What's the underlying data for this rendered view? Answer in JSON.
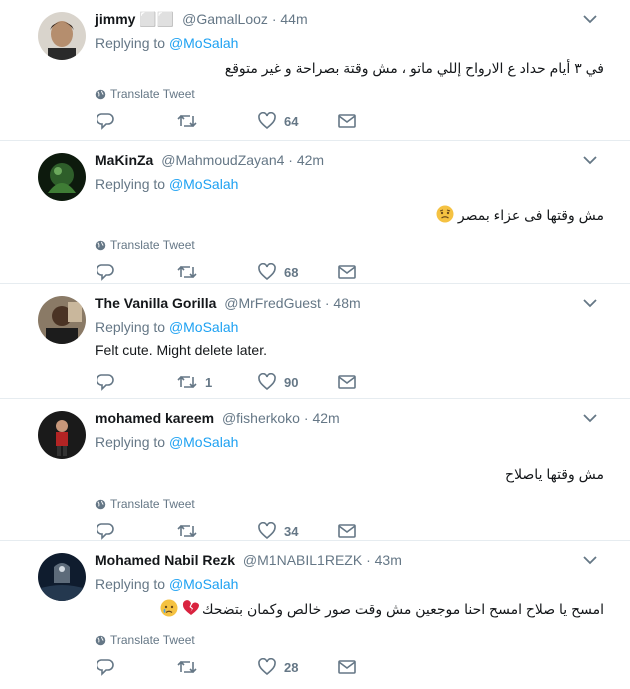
{
  "tweets": [
    {
      "name": "jimmy ⬜⬜",
      "handle": "@GamalLooz",
      "time": "44m",
      "reply_prefix": "Replying to",
      "reply_to": "@MoSalah",
      "text": "في ٣ أيام حداد ع الارواح إللي ماتو ، مش وقتة بصراحة و غير متوقع",
      "rtl": true,
      "translate": "Translate Tweet",
      "retweets": "",
      "likes": "64"
    },
    {
      "name": "MaKinZa",
      "handle": "@MahmoudZayan4",
      "time": "42m",
      "reply_prefix": "Replying to",
      "reply_to": "@MoSalah",
      "text": "مش وقتها فى عزاء بمصر",
      "rtl": true,
      "translate": "Translate Tweet",
      "retweets": "",
      "likes": "68"
    },
    {
      "name": "The Vanilla Gorilla",
      "handle": "@MrFredGuest",
      "time": "48m",
      "reply_prefix": "Replying to",
      "reply_to": "@MoSalah",
      "text": "Felt cute. Might delete later.",
      "rtl": false,
      "translate": "",
      "retweets": "1",
      "likes": "90"
    },
    {
      "name": "mohamed kareem",
      "handle": "@fisherkoko",
      "time": "42m",
      "reply_prefix": "Replying to",
      "reply_to": "@MoSalah",
      "text": "مش وقتها ياصلاح",
      "rtl": true,
      "translate": "Translate Tweet",
      "retweets": "",
      "likes": "34"
    },
    {
      "name": "Mohamed Nabil Rezk",
      "handle": "@M1NABIL1REZK",
      "time": "43m",
      "reply_prefix": "Replying to",
      "reply_to": "@MoSalah",
      "text": "امسح يا صلاح امسح احنا موجعين مش وقت صور خالص وكمان بتضحك",
      "rtl": true,
      "translate": "Translate Tweet",
      "retweets": "",
      "likes": "28"
    }
  ],
  "colors": {
    "accent": "#1da1f2",
    "secondary_text": "#657786",
    "divider": "#e6ecf0"
  },
  "icons": [
    "reply-icon",
    "retweet-icon",
    "like-icon",
    "dm-icon",
    "globe-icon",
    "caret-down-icon"
  ]
}
